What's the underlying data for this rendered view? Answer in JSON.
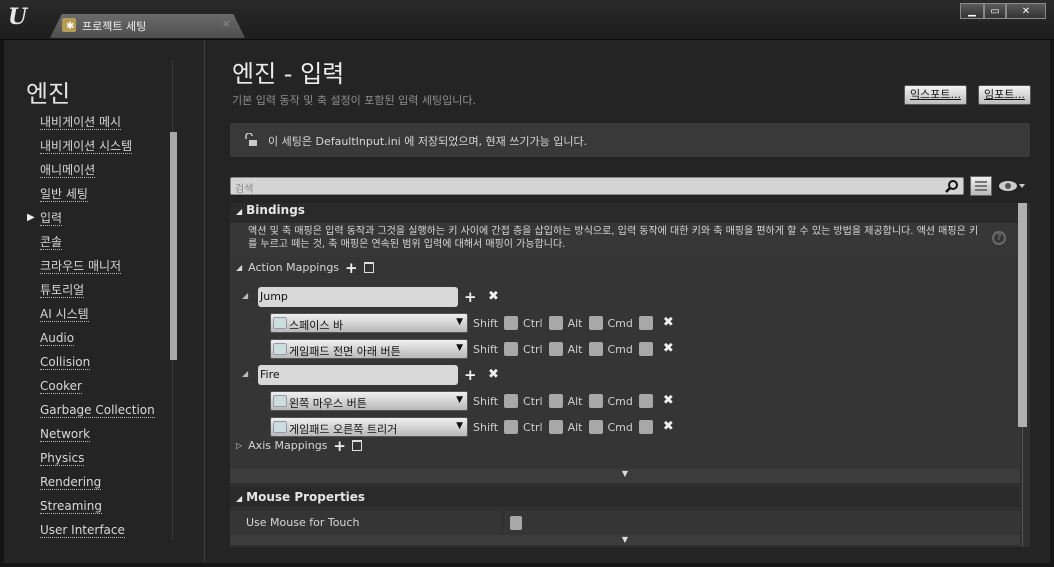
{
  "window": {
    "app_logo": "U",
    "tab_title": "프로젝트 세팅",
    "tab_close": "×",
    "controls": {
      "minimize": "▁",
      "maximize": "▭",
      "close": "✕"
    }
  },
  "sidebar": {
    "section_title": "엔진",
    "selected_index": 4,
    "items": [
      {
        "label": "내비게이션 메시"
      },
      {
        "label": "내비게이션 시스템"
      },
      {
        "label": "애니메이션"
      },
      {
        "label": "일반 세팅"
      },
      {
        "label": "입력"
      },
      {
        "label": "콘솔"
      },
      {
        "label": "크라우드 매니저"
      },
      {
        "label": "튜토리얼"
      },
      {
        "label": "AI 시스템"
      },
      {
        "label": "Audio"
      },
      {
        "label": "Collision"
      },
      {
        "label": "Cooker"
      },
      {
        "label": "Garbage Collection"
      },
      {
        "label": "Network"
      },
      {
        "label": "Physics"
      },
      {
        "label": "Rendering"
      },
      {
        "label": "Streaming"
      },
      {
        "label": "User Interface"
      }
    ]
  },
  "main": {
    "title": "엔진 - 입력",
    "description": "기본 입력 동작 및 축 설정이 포함된 입력 세팅입니다.",
    "export_label": "익스포트...",
    "import_label": "임포트...",
    "notice": "이 세팅은 DefaultInput.ini 에 저장되었으며, 현재 쓰기가능 입니다.",
    "search_placeholder": "검색"
  },
  "bindings": {
    "header": "Bindings",
    "description": "액션 및 축 매핑은 입력 동작과 그것을 실행하는 키 사이에 간접 층을 삽입하는 방식으로, 입력 동작에 대한 키와 축 매핑을 편하게 할 수 있는 방법을 제공합니다. 액션 매핑은 키를 누르고 떼는 것, 축 매핑은 연속된 범위 입력에 대해서 매핑이 가능합니다.",
    "action_mappings_label": "Action Mappings",
    "axis_mappings_label": "Axis Mappings",
    "modifiers": [
      "Shift",
      "Ctrl",
      "Alt",
      "Cmd"
    ],
    "actions": [
      {
        "name": "Jump",
        "keys": [
          {
            "key": "스페이스 바",
            "shift": false,
            "ctrl": false,
            "alt": false,
            "cmd": false
          },
          {
            "key": "게임패드 전면 아래 버튼",
            "shift": false,
            "ctrl": false,
            "alt": false,
            "cmd": false
          }
        ]
      },
      {
        "name": "Fire",
        "keys": [
          {
            "key": "왼쪽 마우스 버튼",
            "shift": false,
            "ctrl": false,
            "alt": false,
            "cmd": false
          },
          {
            "key": "게임패드 오른쪽 트리거",
            "shift": false,
            "ctrl": false,
            "alt": false,
            "cmd": false
          }
        ]
      }
    ]
  },
  "mouse_properties": {
    "header": "Mouse Properties",
    "use_mouse_for_touch_label": "Use Mouse for Touch",
    "use_mouse_for_touch": false
  }
}
